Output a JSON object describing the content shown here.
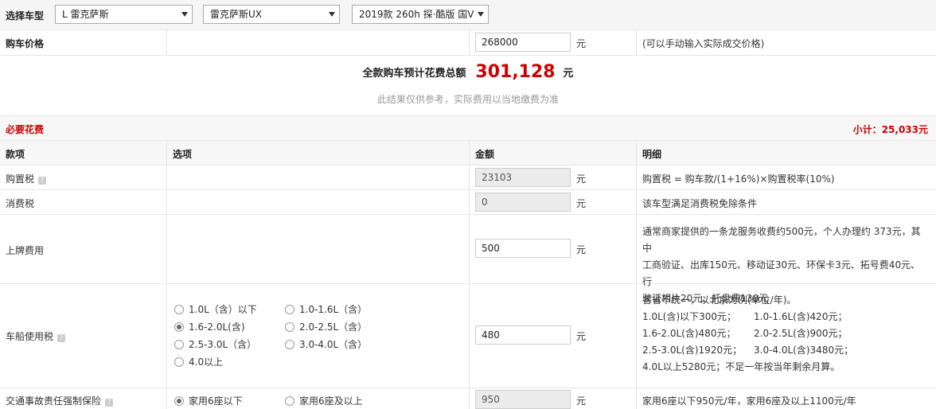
{
  "selector": {
    "label": "选择车型",
    "brand": "L 雷克萨斯",
    "series": "雷克萨斯UX",
    "model": "2019款 260h 探·酷版 国V"
  },
  "price_row": {
    "label": "购车价格",
    "value": "268000",
    "unit": "元",
    "hint": "(可以手动输入实际成交价格)"
  },
  "total": {
    "label": "全款购车预计花费总额",
    "amount": "301,128",
    "unit": "元",
    "note": "此结果仅供参考，实际费用以当地缴费为准"
  },
  "section": {
    "title": "必要花费",
    "subtotal": "小计：25,033元"
  },
  "headers": {
    "item": "款项",
    "option": "选项",
    "amount": "金额",
    "detail": "明细"
  },
  "rows": {
    "purchase_tax": {
      "label": "购置税",
      "value": "23103",
      "unit": "元",
      "detail": "购置税 = 购车款/(1+16%)×购置税率(10%)"
    },
    "consumption_tax": {
      "label": "消费税",
      "value": "0",
      "unit": "元",
      "detail": "该车型满足消费税免除条件"
    },
    "registration": {
      "label": "上牌费用",
      "value": "500",
      "unit": "元",
      "detail_lines": [
        "通常商家提供的一条龙服务收费约500元，个人办理约 373元，其中",
        "工商验证、出库150元、移动证30元、环保卡3元、拓号费40元、行",
        "驶证相片20元、托盘费130元"
      ]
    },
    "vehicle_tax": {
      "label": "车船使用税",
      "value": "480",
      "unit": "元",
      "options": [
        {
          "label": "1.0L（含）以下",
          "selected": false
        },
        {
          "label": "1.0-1.6L（含）",
          "selected": false
        },
        {
          "label": "1.6-2.0L(含)",
          "selected": true
        },
        {
          "label": "2.0-2.5L（含）",
          "selected": false
        },
        {
          "label": "2.5-3.0L（含）",
          "selected": false
        },
        {
          "label": "3.0-4.0L（含）",
          "selected": false
        },
        {
          "label": "4.0以上",
          "selected": false
        }
      ],
      "detail_title": "各省不统一，以北京为例(单位/年)。",
      "detail_pairs": [
        [
          "1.0L(含)以下300元；",
          "1.0-1.6L(含)420元；"
        ],
        [
          "1.6-2.0L(含)480元；",
          "2.0-2.5L(含)900元；"
        ],
        [
          "2.5-3.0L(含)1920元；",
          "3.0-4.0L(含)3480元；"
        ]
      ],
      "detail_last": "4.0L以上5280元；不足一年按当年剩余月算。"
    },
    "insurance": {
      "label": "交通事故责任强制保险",
      "value": "950",
      "unit": "元",
      "options": [
        {
          "label": "家用6座以下",
          "selected": true
        },
        {
          "label": "家用6座及以上",
          "selected": false
        }
      ],
      "detail": "家用6座以下950元/年，家用6座及以上1100元/年"
    }
  },
  "help_glyph": "?"
}
